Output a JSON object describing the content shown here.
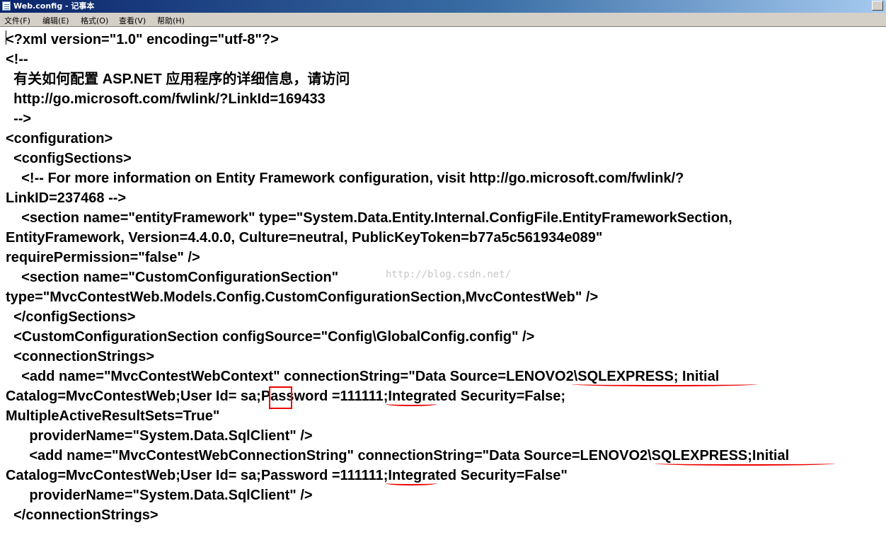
{
  "window": {
    "title": "Web.config - 记事本"
  },
  "menu": [
    "文件(F)",
    "编辑(E)",
    "格式(O)",
    "查看(V)",
    "帮助(H)"
  ],
  "lines": [
    "<?xml version=\"1.0\" encoding=\"utf-8\"?>",
    "<!--",
    "  有关如何配置 ASP.NET 应用程序的详细信息，请访问",
    "  http://go.microsoft.com/fwlink/?LinkId=169433",
    "  -->",
    "<configuration>",
    "  <configSections>",
    "    <!-- For more information on Entity Framework configuration, visit http://go.microsoft.com/fwlink/?",
    "LinkID=237468 -->",
    "    <section name=\"entityFramework\" type=\"System.Data.Entity.Internal.ConfigFile.EntityFrameworkSection,",
    "EntityFramework, Version=4.4.0.0, Culture=neutral, PublicKeyToken=b77a5c561934e089\"",
    "requirePermission=\"false\" />",
    "    <section name=\"CustomConfigurationSection\"",
    "type=\"MvcContestWeb.Models.Config.CustomConfigurationSection,MvcContestWeb\" />",
    "  </configSections>",
    "  <CustomConfigurationSection configSource=\"Config\\GlobalConfig.config\" />",
    "  <connectionStrings>",
    "    <add name=\"MvcContestWebContext\" connectionString=\"Data Source=LENOVO2\\SQLEXPRESS; Initial",
    "Catalog=MvcContestWeb;User Id= sa;Password =111111;Integrated Security=False;",
    "MultipleActiveResultSets=True\"",
    "      providerName=\"System.Data.SqlClient\" />",
    "      <add name=\"MvcContestWebConnectionString\" connectionString=\"Data Source=LENOVO2\\SQLEXPRESS;Initial",
    "Catalog=MvcContestWeb;User Id= sa;Password =111111;Integrated Security=False\"",
    "      providerName=\"System.Data.SqlClient\" />",
    "  </connectionStrings>"
  ],
  "watermark": "http://blog.csdn.net/",
  "colors": {
    "annotation": "#e00000",
    "titlebar": "#0a246a",
    "menubar": "#d4d0c8"
  }
}
